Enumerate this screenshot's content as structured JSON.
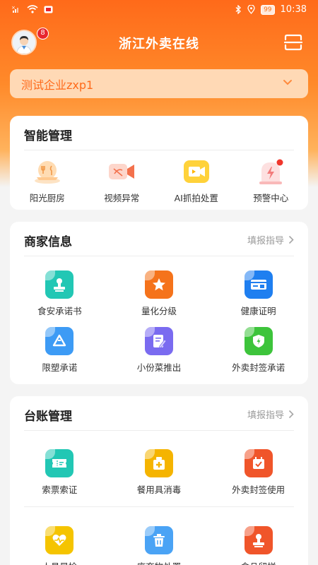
{
  "status_bar": {
    "battery": "99",
    "time": "10:38"
  },
  "header": {
    "title": "浙江外卖在线",
    "badge_count": "8"
  },
  "company": {
    "name": "测试企业zxp1"
  },
  "smart": {
    "title": "智能管理",
    "items": [
      {
        "label": "阳光厨房",
        "icon": "sunshine-kitchen-icon"
      },
      {
        "label": "视频异常",
        "icon": "video-abnormal-icon"
      },
      {
        "label": "AI抓拍处置",
        "icon": "ai-capture-icon"
      },
      {
        "label": "预警中心",
        "icon": "alert-center-icon"
      }
    ]
  },
  "merchant": {
    "title": "商家信息",
    "guide": "填报指导",
    "items": [
      {
        "label": "食安承诺书",
        "icon": "stamp-icon",
        "color": "#22c7b4"
      },
      {
        "label": "量化分级",
        "icon": "star-icon",
        "color": "#f5731b"
      },
      {
        "label": "健康证明",
        "icon": "id-card-icon",
        "color": "#1f7ff0"
      },
      {
        "label": "限塑承诺",
        "icon": "recycle-icon",
        "color": "#3d9bf5"
      },
      {
        "label": "小份菜推出",
        "icon": "edit-document-icon",
        "color": "#7a6bf0"
      },
      {
        "label": "外卖封签承诺",
        "icon": "shield-icon",
        "color": "#3dc43b"
      }
    ]
  },
  "ledger": {
    "title": "台账管理",
    "guide": "填报指导",
    "items": [
      {
        "label": "索票索证",
        "icon": "ticket-icon",
        "color": "#22c7b4"
      },
      {
        "label": "餐用具消毒",
        "icon": "disinfect-icon",
        "color": "#f5b400"
      },
      {
        "label": "外卖封签使用",
        "icon": "calendar-check-icon",
        "color": "#f0552a"
      },
      {
        "label": "人员晨检",
        "icon": "heart-pulse-icon",
        "color": "#f5c400"
      },
      {
        "label": "废弃物处置",
        "icon": "trash-icon",
        "color": "#4aa3f5"
      },
      {
        "label": "食品留样",
        "icon": "sample-stamp-icon",
        "color": "#f0552a"
      }
    ]
  }
}
